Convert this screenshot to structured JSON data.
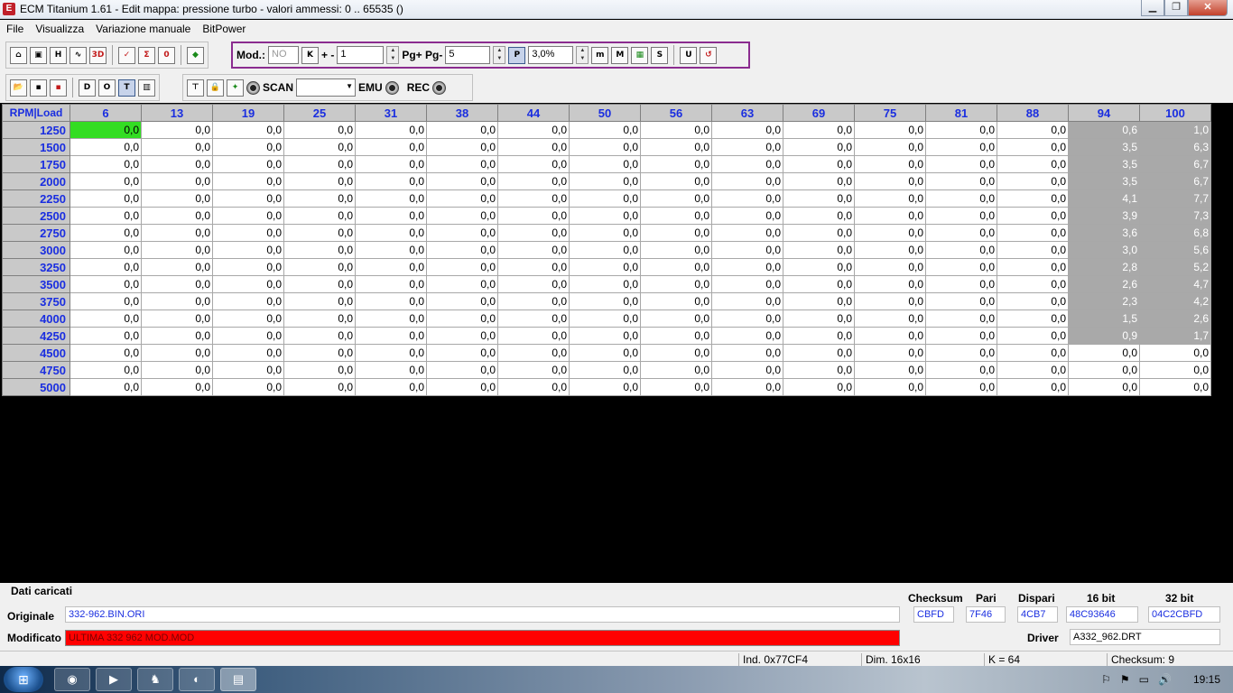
{
  "window": {
    "title": "ECM Titanium 1.61 - Edit mappa: pressione turbo - valori ammessi: 0 .. 65535 ()"
  },
  "menu": [
    "File",
    "Visualizza",
    "Variazione manuale",
    "BitPower"
  ],
  "toolbar": {
    "mod_label": "Mod.:",
    "mod_value": "NO",
    "plusminus_label": "+ -",
    "plusminus_value": "1",
    "page_label": "Pg+ Pg-",
    "page_value": "5",
    "percent_value": "3,0%",
    "scan_label": "SCAN",
    "emu_label": "EMU",
    "rec_label": "REC"
  },
  "grid": {
    "corner": "RPM|Load",
    "columns": [
      "6",
      "13",
      "19",
      "25",
      "31",
      "38",
      "44",
      "50",
      "56",
      "63",
      "69",
      "75",
      "81",
      "88",
      "94",
      "100"
    ],
    "rows": [
      {
        "rpm": "1250",
        "c94": "0,6",
        "c100": "1,0"
      },
      {
        "rpm": "1500",
        "c94": "3,5",
        "c100": "6,3"
      },
      {
        "rpm": "1750",
        "c94": "3,5",
        "c100": "6,7"
      },
      {
        "rpm": "2000",
        "c94": "3,5",
        "c100": "6,7"
      },
      {
        "rpm": "2250",
        "c94": "4,1",
        "c100": "7,7"
      },
      {
        "rpm": "2500",
        "c94": "3,9",
        "c100": "7,3"
      },
      {
        "rpm": "2750",
        "c94": "3,6",
        "c100": "6,8"
      },
      {
        "rpm": "3000",
        "c94": "3,0",
        "c100": "5,6"
      },
      {
        "rpm": "3250",
        "c94": "2,8",
        "c100": "5,2"
      },
      {
        "rpm": "3500",
        "c94": "2,6",
        "c100": "4,7"
      },
      {
        "rpm": "3750",
        "c94": "2,3",
        "c100": "4,2"
      },
      {
        "rpm": "4000",
        "c94": "1,5",
        "c100": "2,6"
      },
      {
        "rpm": "4250",
        "c94": "0,9",
        "c100": "1,7"
      },
      {
        "rpm": "4500",
        "c94": "0,0",
        "c100": "0,0"
      },
      {
        "rpm": "4750",
        "c94": "0,0",
        "c100": "0,0"
      },
      {
        "rpm": "5000",
        "c94": "0,0",
        "c100": "0,0"
      }
    ],
    "default_value": "0,0",
    "highlighted_rows": 13
  },
  "bottom": {
    "section_title": "Dati caricati",
    "original_label": "Originale",
    "original_value": "332-962.BIN.ORI",
    "modified_label": "Modificato",
    "modified_value": "ULTIMA 332 962 MOD.MOD",
    "checksum_header": "Checksum",
    "checksum_value": "CBFD",
    "pari_header": "Pari",
    "pari_value": "7F46",
    "dispari_header": "Dispari",
    "dispari_value": "4CB7",
    "bit16_header": "16 bit",
    "bit16_value": "48C93646",
    "bit32_header": "32 bit",
    "bit32_value": "04C2CBFD",
    "driver_label": "Driver",
    "driver_value": "A332_962.DRT"
  },
  "status": {
    "index": "Ind. 0x77CF4",
    "dimension": "Dim. 16x16",
    "k": "K = 64",
    "checksum": "Checksum: 9"
  },
  "taskbar": {
    "clock": "19:15"
  }
}
